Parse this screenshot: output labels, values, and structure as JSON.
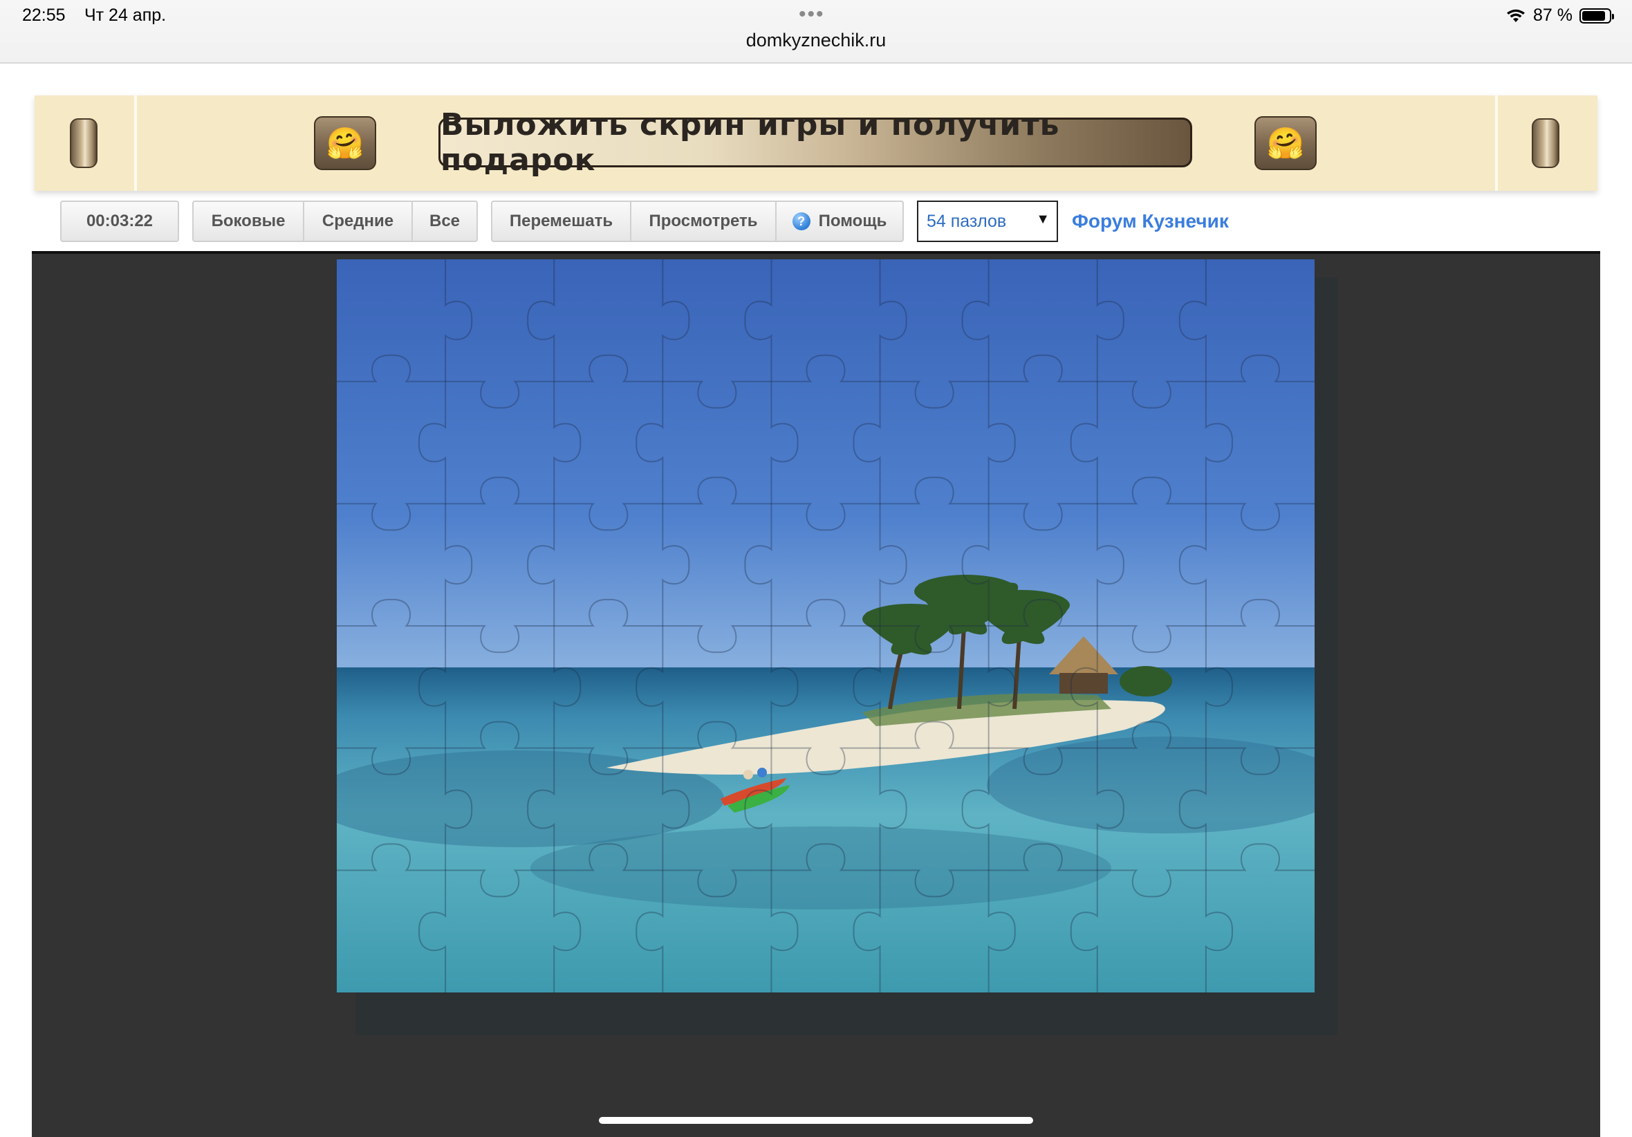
{
  "status_bar": {
    "time": "22:55",
    "date": "Чт 24 апр.",
    "url": "domkyznechik.ru",
    "battery_text": "87 %",
    "battery_level": 0.87
  },
  "banner": {
    "promo_label": "Выложить скрин игры и получить подарок",
    "emoji_left": "🤗",
    "emoji_right": "🤗"
  },
  "toolbar": {
    "timer": "00:03:22",
    "filter_buttons": [
      "Боковые",
      "Средние",
      "Все"
    ],
    "action_buttons": [
      "Перемешать",
      "Просмотреть",
      "Помощь"
    ],
    "help_icon_glyph": "?",
    "pieces_select": {
      "selected": "54 пазлов"
    },
    "forum_link": "Форум Кузнечик"
  },
  "puzzle": {
    "pieces": 54,
    "columns": 9,
    "rows": 6,
    "sky_color": "#3f6fc0",
    "sea_color": "#3f9cb3"
  }
}
